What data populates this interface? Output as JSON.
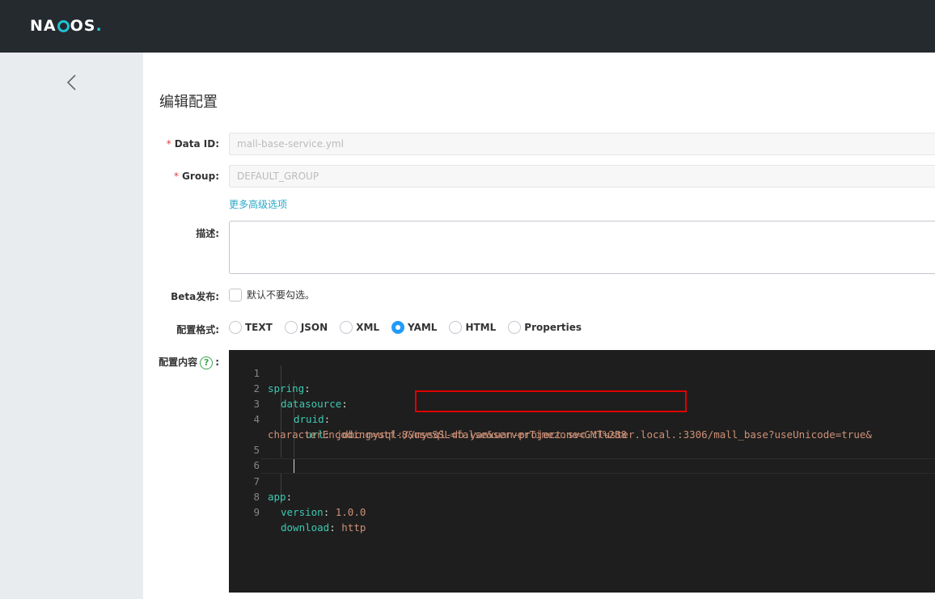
{
  "brand": {
    "logo_left": "NA",
    "logo_right": "OS",
    "logo_dot": "."
  },
  "page": {
    "title": "编辑配置"
  },
  "form": {
    "data_id": {
      "required_mark": "*",
      "label": "Data ID:",
      "value": "mall-base-service.yml"
    },
    "group": {
      "required_mark": "*",
      "label": "Group:",
      "value": "DEFAULT_GROUP"
    },
    "advanced_link": "更多高级选项",
    "description": {
      "label": "描述:",
      "value": ""
    },
    "beta": {
      "label": "Beta发布:",
      "checkbox_text": "默认不要勾选。"
    },
    "format": {
      "label": "配置格式:",
      "options": [
        "TEXT",
        "JSON",
        "XML",
        "YAML",
        "HTML",
        "Properties"
      ],
      "selected": "YAML"
    },
    "content": {
      "label": "配置内容",
      "help_icon": "?",
      "colon": ":"
    }
  },
  "editor": {
    "line_numbers": [
      "1",
      "2",
      "3",
      "4",
      "5",
      "6",
      "7",
      "8",
      "9"
    ],
    "tokens": {
      "l1_key": "spring",
      "l1_colon": ":",
      "l2_key": "datasource",
      "l2_colon": ":",
      "l3_key": "druid",
      "l3_colon": ":",
      "l4_key": "url",
      "l4_colon": ":",
      "l4_value": "jdbc:mysql://mysql-db.yanxuan-project.svc.cluster.local.:3306/mall_base?useUnicode=true&",
      "l4_wrap": "characterEncoding=utf-8&useSSL=false&serverTimezone=GMT%2B8",
      "l7_key": "app",
      "l7_colon": ":",
      "l8_key": "version",
      "l8_colon": ":",
      "l8_value": "1.0.0",
      "l9_key": "download",
      "l9_colon": ":",
      "l9_value": "http"
    }
  },
  "colors": {
    "topbar": "#252a2f",
    "sidebar": "#e9ecef",
    "accent": "#1ec3d3",
    "link": "#2ba9c8",
    "radio_checked": "#209bfa",
    "editor_bg": "#1e1e1e",
    "yaml_key": "#3dc9b0",
    "yaml_value": "#ce9178",
    "highlight_box": "#e10000"
  }
}
